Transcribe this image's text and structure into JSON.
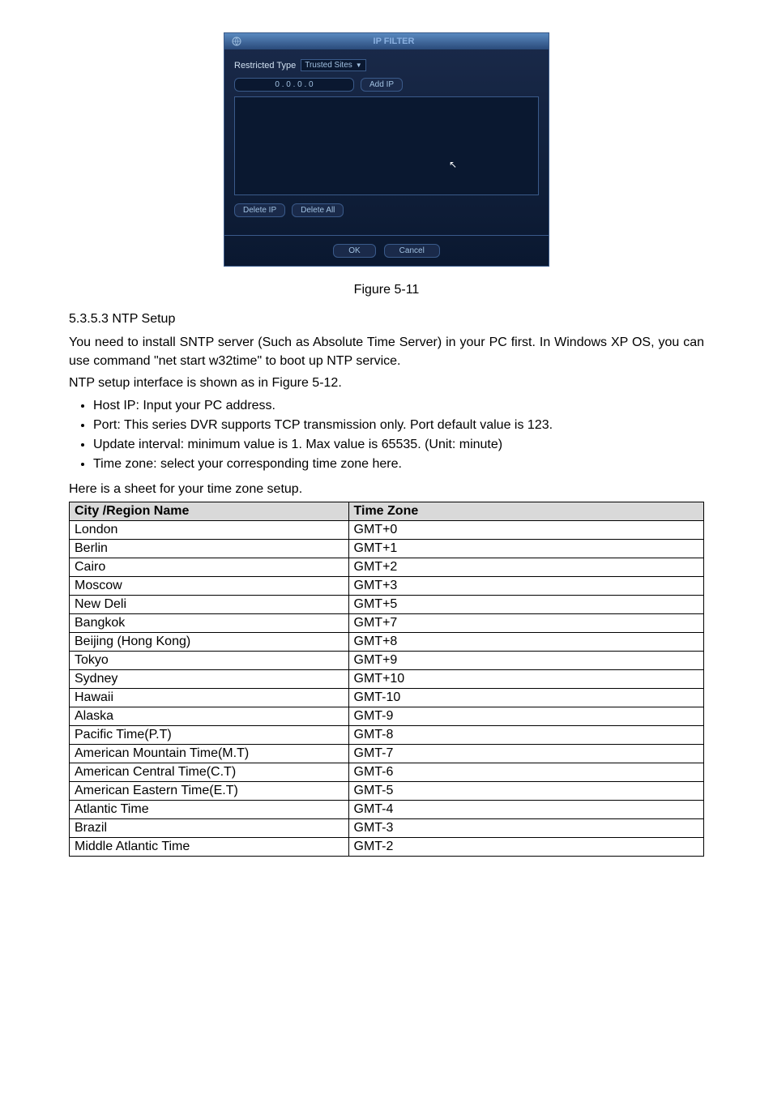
{
  "dialog": {
    "title": "IP FILTER",
    "restricted_label": "Restricted Type",
    "restricted_value": "Trusted Sites",
    "ip_value": "0   .   0   .   0   .   0",
    "add_ip": "Add IP",
    "delete_ip": "Delete IP",
    "delete_all": "Delete All",
    "ok": "OK",
    "cancel": "Cancel"
  },
  "figure_caption": "Figure 5-11",
  "section": {
    "heading": "5.3.5.3  NTP Setup",
    "para1": "You need to install SNTP server (Such as Absolute Time Server) in your PC first. In Windows XP OS, you can use command \"net start w32time\" to boot up NTP service.",
    "para2": "NTP setup interface is shown as in Figure 5-12.",
    "bullets": [
      "Host IP: Input your PC address.",
      "Port:   This series DVR supports TCP transmission only. Port default value is 123.",
      "Update interval: minimum value is 1. Max value is 65535. (Unit: minute)",
      "Time zone: select your corresponding time zone here."
    ],
    "sheet_note": "Here is a sheet for your time zone setup."
  },
  "table": {
    "headers": [
      "City /Region Name",
      "Time Zone"
    ],
    "rows": [
      [
        "London",
        "GMT+0"
      ],
      [
        "Berlin",
        "GMT+1"
      ],
      [
        "Cairo",
        "GMT+2"
      ],
      [
        "Moscow",
        "GMT+3"
      ],
      [
        "New Deli",
        "GMT+5"
      ],
      [
        "Bangkok",
        "GMT+7"
      ],
      [
        "Beijing (Hong Kong)",
        "GMT+8"
      ],
      [
        "Tokyo",
        "GMT+9"
      ],
      [
        "Sydney",
        "GMT+10"
      ],
      [
        "Hawaii",
        "GMT-10"
      ],
      [
        "Alaska",
        "GMT-9"
      ],
      [
        "Pacific Time(P.T)",
        "GMT-8"
      ],
      [
        "American   Mountain Time(M.T)",
        "GMT-7"
      ],
      [
        "American Central Time(C.T)",
        "GMT-6"
      ],
      [
        "American Eastern Time(E.T)",
        "GMT-5"
      ],
      [
        "Atlantic Time",
        "GMT-4"
      ],
      [
        "Brazil",
        "GMT-3"
      ],
      [
        "Middle Atlantic Time",
        "GMT-2"
      ]
    ]
  }
}
